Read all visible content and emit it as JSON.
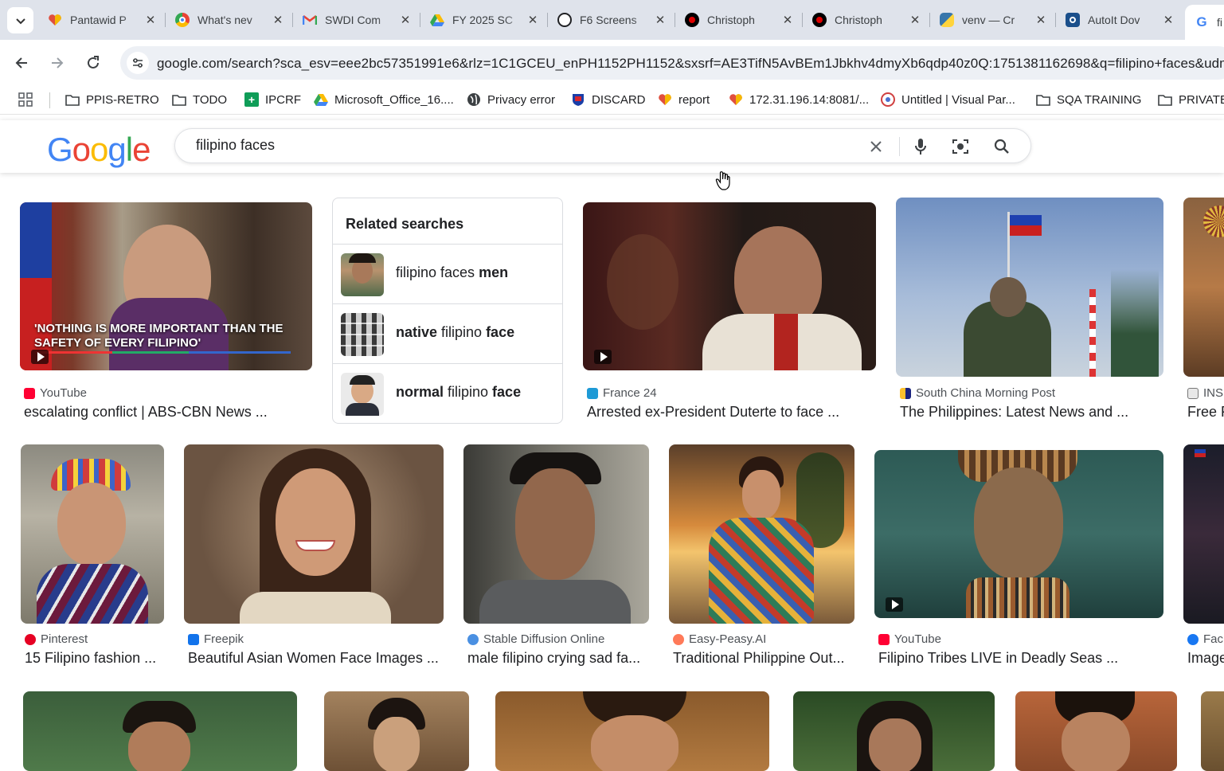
{
  "browser": {
    "tabs": [
      {
        "title": "Pantawid P",
        "icon": "heart-favicon-icon",
        "color": "#e04f3f"
      },
      {
        "title": "What's nev",
        "icon": "chrome-favicon-icon",
        "color": "#34a853"
      },
      {
        "title": "SWDI Com",
        "icon": "gmail-favicon-icon",
        "color": "#ea4335"
      },
      {
        "title": "FY 2025 SC",
        "icon": "drive-favicon-icon",
        "color": "#fbbc04"
      },
      {
        "title": "F6 Screens",
        "icon": "openai-favicon-icon",
        "color": "#202124"
      },
      {
        "title": "Christoph",
        "icon": "redcircle-favicon-icon",
        "color": "#c00000"
      },
      {
        "title": "Christoph",
        "icon": "redcircle-favicon-icon",
        "color": "#c00000"
      },
      {
        "title": "venv — Cr",
        "icon": "python-favicon-icon",
        "color": "#3776ab"
      },
      {
        "title": "AutoIt Dov",
        "icon": "autoit-favicon-icon",
        "color": "#1a4f8b"
      },
      {
        "title": "fi",
        "icon": "google-favicon-icon",
        "color": "#4285f4"
      }
    ],
    "url": "google.com/search?sca_esv=eee2bc57351991e6&rlz=1C1GCEU_enPH1152PH1152&sxsrf=AE3TifN5AvBEm1Jbkhv4dmyXb6qdp40z0Q:1751381162698&q=filipino+faces&udm",
    "bookmarks": [
      {
        "label": "PPIS-RETRO",
        "icon": "folder-icon"
      },
      {
        "label": "TODO",
        "icon": "folder-icon"
      },
      {
        "label": "IPCRF",
        "icon": "sheets-icon"
      },
      {
        "label": "Microsoft_Office_16....",
        "icon": "drive-icon"
      },
      {
        "label": "Privacy error",
        "icon": "globe-icon"
      },
      {
        "label": "DISCARD",
        "icon": "shield-icon"
      },
      {
        "label": "report",
        "icon": "heart-icon"
      },
      {
        "label": "172.31.196.14:8081/...",
        "icon": "heart-icon"
      },
      {
        "label": "Untitled | Visual Par...",
        "icon": "vp-icon"
      },
      {
        "label": "SQA TRAINING",
        "icon": "folder-icon"
      },
      {
        "label": "PRIVATE",
        "icon": "folder-icon"
      }
    ]
  },
  "search": {
    "query": "filipino faces"
  },
  "related": {
    "title": "Related searches",
    "items": [
      {
        "pre": "",
        "mid": "filipino faces",
        "bold": "men"
      },
      {
        "pre": "native",
        "mid": " filipino ",
        "bold": "face"
      },
      {
        "pre": "normal",
        "mid": " filipino ",
        "bold": "face"
      }
    ]
  },
  "results": {
    "row1": [
      {
        "source": "YouTube",
        "caption": "escalating conflict | ABS-CBN News ...",
        "overlay": "'NOTHING IS MORE IMPORTANT THAN THE SAFETY OF EVERY FILIPINO'"
      },
      {
        "source": "France 24",
        "caption": "Arrested ex-President Duterte to face ..."
      },
      {
        "source": "South China Morning Post",
        "caption": "The Philippines: Latest News and ..."
      },
      {
        "source": "INS",
        "caption": "Free F"
      }
    ],
    "row2": [
      {
        "source": "Pinterest",
        "caption": "15 Filipino fashion ..."
      },
      {
        "source": "Freepik",
        "caption": "Beautiful Asian Women Face Images ..."
      },
      {
        "source": "Stable Diffusion Online",
        "caption": "male filipino crying sad fa..."
      },
      {
        "source": "Easy-Peasy.AI",
        "caption": "Traditional Philippine Out..."
      },
      {
        "source": "YouTube",
        "caption": "Filipino Tribes LIVE in Deadly Seas ..."
      },
      {
        "source": "Fac",
        "caption": "Image"
      }
    ]
  },
  "colors": {
    "tabstrip": "#dfe3eb",
    "omnibox": "#edf0f5",
    "google_blue": "#4285f4",
    "google_red": "#ea4335",
    "google_yellow": "#fbbc05",
    "google_green": "#34a853"
  }
}
